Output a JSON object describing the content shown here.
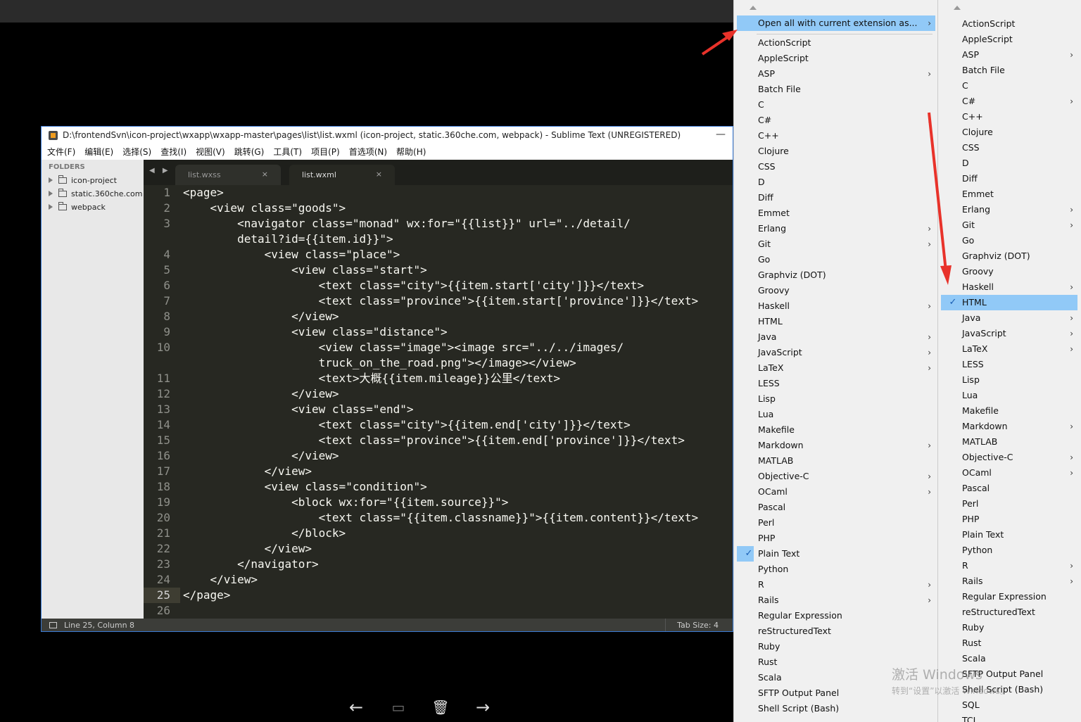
{
  "window": {
    "title": "D:\\frontendSvn\\icon-project\\wxapp\\wxapp-master\\pages\\list\\list.wxml (icon-project, static.360che.com, webpack) - Sublime Text (UNREGISTERED)",
    "minimize": "—"
  },
  "menubar": [
    "文件(F)",
    "编辑(E)",
    "选择(S)",
    "查找(I)",
    "视图(V)",
    "跳转(G)",
    "工具(T)",
    "项目(P)",
    "首选项(N)",
    "帮助(H)"
  ],
  "sidebar": {
    "header": "FOLDERS",
    "folders": [
      "icon-project",
      "static.360che.com",
      "webpack"
    ]
  },
  "tabs": {
    "nav": "◀ ▶",
    "items": [
      {
        "label": "list.wxss",
        "close": "×"
      },
      {
        "label": "list.wxml",
        "close": "×"
      }
    ]
  },
  "code": {
    "lines": [
      {
        "n": "1",
        "text": "<page>"
      },
      {
        "n": "2",
        "text": "    <view class=\"goods\">"
      },
      {
        "n": "3",
        "text": "        <navigator class=\"monad\" wx:for=\"{{list}}\" url=\"../detail/"
      },
      {
        "n": "",
        "text": "        detail?id={{item.id}}\">"
      },
      {
        "n": "4",
        "text": "            <view class=\"place\">"
      },
      {
        "n": "5",
        "text": "                <view class=\"start\">"
      },
      {
        "n": "6",
        "text": "                    <text class=\"city\">{{item.start['city']}}</text>"
      },
      {
        "n": "7",
        "text": "                    <text class=\"province\">{{item.start['province']}}</text>"
      },
      {
        "n": "8",
        "text": "                </view>"
      },
      {
        "n": "9",
        "text": "                <view class=\"distance\">"
      },
      {
        "n": "10",
        "text": "                    <view class=\"image\"><image src=\"../../images/"
      },
      {
        "n": "",
        "text": "                    truck_on_the_road.png\"></image></view>"
      },
      {
        "n": "11",
        "text": "                    <text>大概{{item.mileage}}公里</text>"
      },
      {
        "n": "12",
        "text": "                </view>"
      },
      {
        "n": "13",
        "text": "                <view class=\"end\">"
      },
      {
        "n": "14",
        "text": "                    <text class=\"city\">{{item.end['city']}}</text>"
      },
      {
        "n": "15",
        "text": "                    <text class=\"province\">{{item.end['province']}}</text>"
      },
      {
        "n": "16",
        "text": "                </view>"
      },
      {
        "n": "17",
        "text": "            </view>"
      },
      {
        "n": "18",
        "text": "            <view class=\"condition\">"
      },
      {
        "n": "19",
        "text": "                <block wx:for=\"{{item.source}}\">"
      },
      {
        "n": "20",
        "text": "                    <text class=\"{{item.classname}}\">{{item.content}}</text>"
      },
      {
        "n": "21",
        "text": "                </block>"
      },
      {
        "n": "22",
        "text": "            </view>"
      },
      {
        "n": "23",
        "text": "        </navigator>"
      },
      {
        "n": "24",
        "text": "    </view>"
      },
      {
        "n": "25",
        "text": "</page>"
      },
      {
        "n": "26",
        "text": ""
      }
    ],
    "current_line": "25"
  },
  "statusbar": {
    "position": "Line 25, Column 8",
    "tab_size": "Tab Size: 4"
  },
  "controls": {
    "prev": "←",
    "slideshow": "▭",
    "delete": "🗑",
    "next": "→"
  },
  "menu1": {
    "header": "Open all with current extension as...",
    "items": [
      {
        "label": "ActionScript",
        "sub": false
      },
      {
        "label": "AppleScript",
        "sub": false
      },
      {
        "label": "ASP",
        "sub": true
      },
      {
        "label": "Batch File",
        "sub": false
      },
      {
        "label": "C",
        "sub": false
      },
      {
        "label": "C#",
        "sub": true
      },
      {
        "label": "C++",
        "sub": false
      },
      {
        "label": "Clojure",
        "sub": false
      },
      {
        "label": "CSS",
        "sub": false
      },
      {
        "label": "D",
        "sub": false
      },
      {
        "label": "Diff",
        "sub": false
      },
      {
        "label": "Emmet",
        "sub": false
      },
      {
        "label": "Erlang",
        "sub": true
      },
      {
        "label": "Git",
        "sub": true
      },
      {
        "label": "Go",
        "sub": false
      },
      {
        "label": "Graphviz (DOT)",
        "sub": false
      },
      {
        "label": "Groovy",
        "sub": false
      },
      {
        "label": "Haskell",
        "sub": true
      },
      {
        "label": "HTML",
        "sub": false
      },
      {
        "label": "Java",
        "sub": true
      },
      {
        "label": "JavaScript",
        "sub": true
      },
      {
        "label": "LaTeX",
        "sub": true
      },
      {
        "label": "LESS",
        "sub": false
      },
      {
        "label": "Lisp",
        "sub": false
      },
      {
        "label": "Lua",
        "sub": false
      },
      {
        "label": "Makefile",
        "sub": false
      },
      {
        "label": "Markdown",
        "sub": true
      },
      {
        "label": "MATLAB",
        "sub": false
      },
      {
        "label": "Objective-C",
        "sub": true
      },
      {
        "label": "OCaml",
        "sub": true
      },
      {
        "label": "Pascal",
        "sub": false
      },
      {
        "label": "Perl",
        "sub": false
      },
      {
        "label": "PHP",
        "sub": false
      },
      {
        "label": "Plain Text",
        "sub": false,
        "checked": true
      },
      {
        "label": "Python",
        "sub": false
      },
      {
        "label": "R",
        "sub": true
      },
      {
        "label": "Rails",
        "sub": true
      },
      {
        "label": "Regular Expression",
        "sub": false
      },
      {
        "label": "reStructuredText",
        "sub": false
      },
      {
        "label": "Ruby",
        "sub": false
      },
      {
        "label": "Rust",
        "sub": false
      },
      {
        "label": "Scala",
        "sub": false
      },
      {
        "label": "SFTP Output Panel",
        "sub": false
      },
      {
        "label": "Shell Script (Bash)",
        "sub": false
      }
    ]
  },
  "menu2": {
    "items": [
      {
        "label": "ActionScript",
        "sub": false
      },
      {
        "label": "AppleScript",
        "sub": false
      },
      {
        "label": "ASP",
        "sub": true
      },
      {
        "label": "Batch File",
        "sub": false
      },
      {
        "label": "C",
        "sub": false
      },
      {
        "label": "C#",
        "sub": true
      },
      {
        "label": "C++",
        "sub": false
      },
      {
        "label": "Clojure",
        "sub": false
      },
      {
        "label": "CSS",
        "sub": false
      },
      {
        "label": "D",
        "sub": false
      },
      {
        "label": "Diff",
        "sub": false
      },
      {
        "label": "Emmet",
        "sub": false
      },
      {
        "label": "Erlang",
        "sub": true
      },
      {
        "label": "Git",
        "sub": true
      },
      {
        "label": "Go",
        "sub": false
      },
      {
        "label": "Graphviz (DOT)",
        "sub": false
      },
      {
        "label": "Groovy",
        "sub": false
      },
      {
        "label": "Haskell",
        "sub": true
      },
      {
        "label": "HTML",
        "sub": false,
        "checked": true
      },
      {
        "label": "Java",
        "sub": true
      },
      {
        "label": "JavaScript",
        "sub": true
      },
      {
        "label": "LaTeX",
        "sub": true
      },
      {
        "label": "LESS",
        "sub": false
      },
      {
        "label": "Lisp",
        "sub": false
      },
      {
        "label": "Lua",
        "sub": false
      },
      {
        "label": "Makefile",
        "sub": false
      },
      {
        "label": "Markdown",
        "sub": true
      },
      {
        "label": "MATLAB",
        "sub": false
      },
      {
        "label": "Objective-C",
        "sub": true
      },
      {
        "label": "OCaml",
        "sub": true
      },
      {
        "label": "Pascal",
        "sub": false
      },
      {
        "label": "Perl",
        "sub": false
      },
      {
        "label": "PHP",
        "sub": false
      },
      {
        "label": "Plain Text",
        "sub": false
      },
      {
        "label": "Python",
        "sub": false
      },
      {
        "label": "R",
        "sub": true
      },
      {
        "label": "Rails",
        "sub": true
      },
      {
        "label": "Regular Expression",
        "sub": false
      },
      {
        "label": "reStructuredText",
        "sub": false
      },
      {
        "label": "Ruby",
        "sub": false
      },
      {
        "label": "Rust",
        "sub": false
      },
      {
        "label": "Scala",
        "sub": false
      },
      {
        "label": "SFTP Output Panel",
        "sub": false
      },
      {
        "label": "Shell Script (Bash)",
        "sub": false
      },
      {
        "label": "SQL",
        "sub": false
      },
      {
        "label": "TCL",
        "sub": false
      }
    ]
  },
  "watermark": {
    "line1": "激活 Windows",
    "line2": "转到“设置”以激活 Windows。"
  },
  "colors": {
    "highlight": "#91c9f7",
    "annotation_arrow": "#e8322a",
    "editor_bg": "#272822"
  }
}
